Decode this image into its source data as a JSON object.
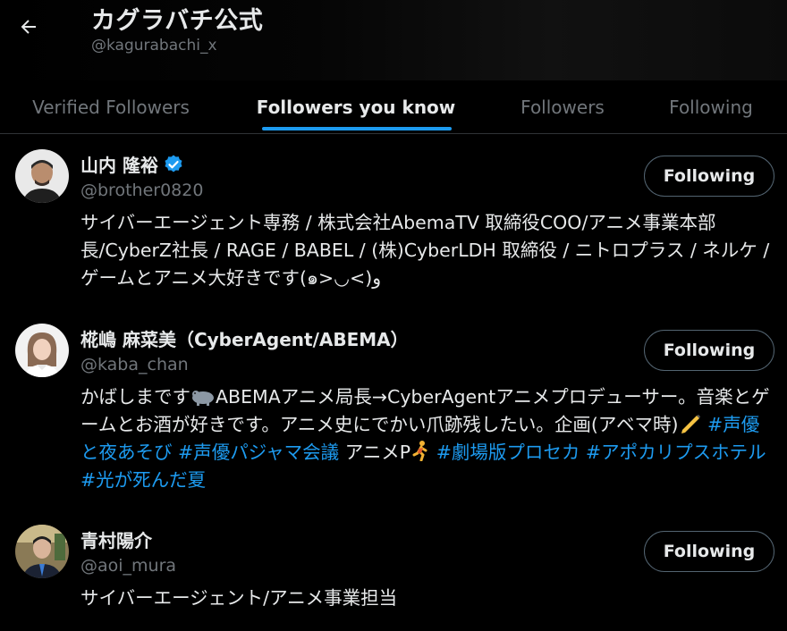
{
  "header": {
    "title": "カグラバチ公式",
    "handle": "@kagurabachi_x"
  },
  "tabs": [
    {
      "label": "Verified Followers",
      "active": false
    },
    {
      "label": "Followers you know",
      "active": true
    },
    {
      "label": "Followers",
      "active": false
    },
    {
      "label": "Following",
      "active": false
    }
  ],
  "users": [
    {
      "name": "山内 隆裕",
      "verified": true,
      "handle": "@brother0820",
      "button": "Following",
      "bio": "サイバーエージェント専務 / 株式会社AbemaTV 取締役COO/アニメ事業本部長/CyberZ社長 / RAGE / BABEL / (株)CyberLDH 取締役 / ニトロプラス / ネルケ /ゲームとアニメ大好きです(๑>◡<)و"
    },
    {
      "name": "椛嶋 麻菜美（CyberAgent/ABEMA）",
      "verified": false,
      "handle": "@kaba_chan",
      "button": "Following",
      "bio_part1": "かばしまです",
      "bio_part2": "ABEMAアニメ局長→CyberAgentアニメプロデューサー。音楽とゲームとお酒が好きです。アニメ史にでかい爪跡残したい。企画(アベマ時)",
      "hashtag1": "#声優と夜あそび",
      "hashtag2": "#声優パジャマ会議",
      "bio_part3": " アニメP",
      "hashtag3": "#劇場版プロセカ",
      "hashtag4": "#アポカリプスホテル",
      "hashtag5": "#光が死んだ夏"
    },
    {
      "name": "青村陽介",
      "verified": false,
      "handle": "@aoi_mura",
      "button": "Following",
      "bio": "サイバーエージェント/アニメ事業担当"
    }
  ],
  "colors": {
    "accent": "#1d9bf0",
    "text_primary": "#e7e9ea",
    "text_secondary": "#71767b",
    "background": "#000000"
  },
  "icons": {
    "back": "arrow-left-icon",
    "verified": "verified-badge-icon"
  }
}
